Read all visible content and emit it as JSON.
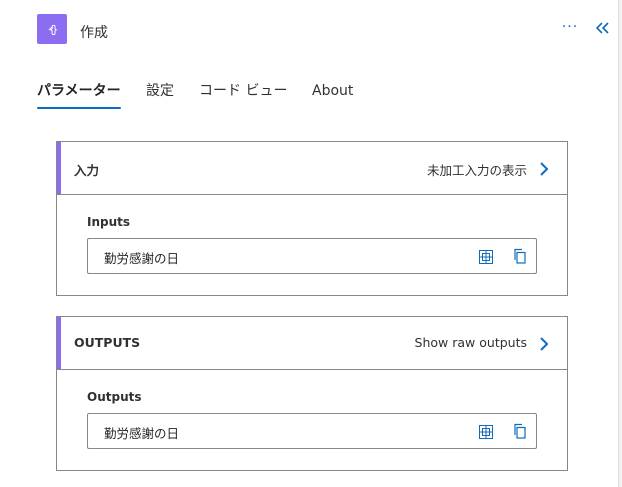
{
  "header": {
    "title": "作成",
    "app_icon": "compose-braces-icon",
    "accent_color": "#8c6cf0",
    "more_label": "···",
    "collapse_icon": "double-chevron-left-icon"
  },
  "tabs": [
    {
      "label": "パラメーター",
      "active": true
    },
    {
      "label": "設定",
      "active": false
    },
    {
      "label": "コード ビュー",
      "active": false
    },
    {
      "label": "About",
      "active": false
    }
  ],
  "inputs_card": {
    "title": "入力",
    "raw_link": "未加工入力の表示",
    "field_label": "Inputs",
    "field_value": "勤労感謝の日"
  },
  "outputs_card": {
    "title": "OUTPUTS",
    "raw_link": "Show raw outputs",
    "field_label": "Outputs",
    "field_value": "勤労感謝の日"
  }
}
